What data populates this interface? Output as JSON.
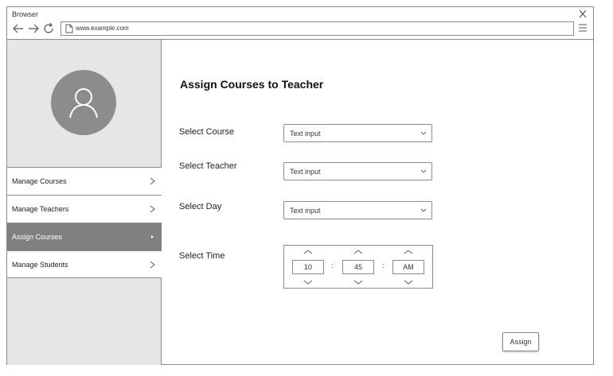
{
  "browser": {
    "title": "Browser",
    "url": "www.example.com"
  },
  "sidebar": {
    "items": [
      {
        "label": "Manage Courses",
        "active": false
      },
      {
        "label": "Manage Teachers",
        "active": false
      },
      {
        "label": "Assign Courses",
        "active": true
      },
      {
        "label": "Manage Students",
        "active": false
      }
    ]
  },
  "main": {
    "title": "Assign Courses to Teacher",
    "course": {
      "label": "Select Course",
      "value": "Text input"
    },
    "teacher": {
      "label": "Select Teacher",
      "value": "Text input"
    },
    "day": {
      "label": "Select Day",
      "value": "Text input"
    },
    "time": {
      "label": "Select Time",
      "hour": "10",
      "minute": "45",
      "period": "AM",
      "separator": ":"
    },
    "assign_label": "Assign"
  },
  "icons": {
    "close": "close-icon",
    "back": "back-arrow-icon",
    "forward": "forward-arrow-icon",
    "reload": "reload-icon",
    "page": "page-icon",
    "menu": "hamburger-menu-icon",
    "avatar": "user-icon"
  },
  "colors": {
    "sidebar_bg": "#e6e6e6",
    "active_item_bg": "#808080",
    "avatar_bg": "#8c8c8c",
    "border": "#8a8a8a"
  }
}
